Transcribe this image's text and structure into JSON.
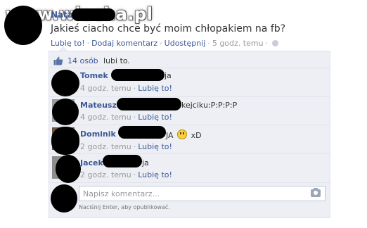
{
  "watermark": "www.wiocha.pl",
  "post": {
    "author": "Natalia",
    "text": "Jakieś ciacho chce być moim chłopakiem na fb?",
    "meta": {
      "like": "Lubię to!",
      "comment": "Dodaj komentarz",
      "share": "Udostępnij",
      "time": "5 godz. temu",
      "separator": "·"
    }
  },
  "likes": {
    "count_link": "14 osób",
    "suffix": "lubi to."
  },
  "comments": [
    {
      "name": "Tomek",
      "text_visible": "ja",
      "time": "4 godz. temu",
      "like": "Lubię to!"
    },
    {
      "name": "Mateusz",
      "text_visible": "kejciku:P:P:P:P",
      "time": "4 godz. temu",
      "like": "Lubię to!"
    },
    {
      "name": "Dominik",
      "text_visible": "JA",
      "text_after": "xD",
      "time": "2 godz. temu",
      "like": "Lubię to!"
    },
    {
      "name": "Jacek",
      "text_visible": "ja",
      "time": "2 godz. temu",
      "like": "Lubię to!"
    }
  ],
  "composer": {
    "placeholder": "Napisz komentarz...",
    "hint": "Naciśnij Enter, aby opublikować."
  },
  "colors": {
    "link": "#3b5998",
    "box_bg": "#edeff4",
    "meta": "#999999"
  }
}
